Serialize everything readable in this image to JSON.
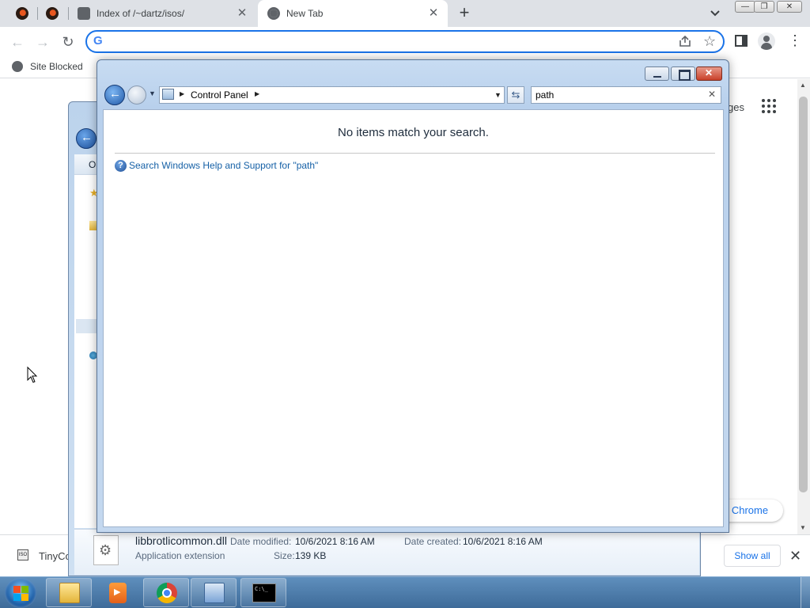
{
  "browser": {
    "tabs": [
      {
        "title": "",
        "icon": "flame-favicon-icon"
      },
      {
        "title": "",
        "icon": "flame-favicon-icon"
      },
      {
        "title": "Index of /~dartz/isos/",
        "icon": "site-favicon-icon"
      },
      {
        "title": "New Tab",
        "icon": "chrome-favicon-icon",
        "active": true
      }
    ],
    "tab_close_glyph": "✕",
    "new_tab_glyph": "+",
    "omnibox_value": "",
    "bookmark_bar": {
      "site_blocked": "Site Blocked"
    },
    "ntp_partial_text": "ges",
    "customize_button": "e Chrome",
    "downloads": {
      "item_name": "TinyCo",
      "show_all": "Show all"
    }
  },
  "background_explorer": {
    "details": {
      "file_name": "libbrotlicommon.dll",
      "date_modified_label": "Date modified:",
      "date_modified": "10/6/2021 8:16 AM",
      "date_created_label": "Date created:",
      "date_created": "10/6/2021 8:16 AM",
      "type": "Application extension",
      "size_label": "Size:",
      "size": "139 KB"
    },
    "partial_toolbar": "O"
  },
  "control_panel": {
    "breadcrumb": "Control Panel",
    "search_value": "path",
    "no_items_message": "No items match your search.",
    "help_link": "Search Windows Help and Support for \"path\""
  },
  "taskbar": {
    "cmd_text": "C:\\_"
  },
  "colors": {
    "chrome_accent": "#1a73e8",
    "win7_link": "#1560a6",
    "taskbar": "#4a78a8"
  }
}
